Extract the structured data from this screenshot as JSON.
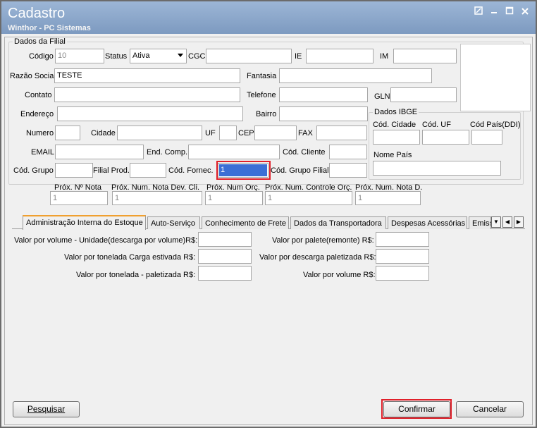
{
  "window": {
    "title": "Cadastro",
    "subtitle": "Winthor - PC Sistemas"
  },
  "dados_filial": {
    "group_title": "Dados da Filial",
    "codigo": {
      "label": "Código",
      "value": "10"
    },
    "status": {
      "label": "Status",
      "value": "Ativa"
    },
    "cgc": {
      "label": "CGC",
      "value": ""
    },
    "ie": {
      "label": "IE",
      "value": ""
    },
    "im": {
      "label": "IM",
      "value": ""
    },
    "razao_social": {
      "label": "Razão Social",
      "value": "TESTE"
    },
    "fantasia": {
      "label": "Fantasia",
      "value": ""
    },
    "contato": {
      "label": "Contato",
      "value": ""
    },
    "telefone": {
      "label": "Telefone",
      "value": ""
    },
    "gln": {
      "label": "GLN",
      "value": ""
    },
    "endereco": {
      "label": "Endereço",
      "value": ""
    },
    "bairro": {
      "label": "Bairro",
      "value": ""
    },
    "numero": {
      "label": "Numero",
      "value": ""
    },
    "cidade": {
      "label": "Cidade",
      "value": ""
    },
    "uf": {
      "label": "UF",
      "value": ""
    },
    "cep": {
      "label": "CEP",
      "value": ""
    },
    "fax": {
      "label": "FAX",
      "value": ""
    },
    "email": {
      "label": "EMAIL",
      "value": ""
    },
    "end_comp": {
      "label": "End. Comp.",
      "value": ""
    },
    "cod_cliente": {
      "label": "Cód. Cliente",
      "value": ""
    },
    "cod_grupo": {
      "label": "Cód. Grupo",
      "value": ""
    },
    "filial_prod": {
      "label": "Filial Prod.",
      "value": ""
    },
    "cod_fornec": {
      "label": "Cód. Fornec.",
      "value": "1"
    },
    "cod_grupo_filial": {
      "label": "Cód. Grupo Filial",
      "value": ""
    }
  },
  "dados_ibge": {
    "group_title": "Dados IBGE",
    "cod_cidade": {
      "label": "Cód. Cidade",
      "value": ""
    },
    "cod_uf": {
      "label": "Cód. UF",
      "value": ""
    },
    "cod_pais": {
      "label": "Cód País(DDI)",
      "value": ""
    },
    "nome_pais": {
      "label": "Nome País",
      "value": ""
    }
  },
  "proximos": [
    {
      "label": "Próx. Nº Nota",
      "value": "1"
    },
    {
      "label": "Próx. Num. Nota Dev. Cli.",
      "value": "1"
    },
    {
      "label": "Próx. Num Orç.",
      "value": "1"
    },
    {
      "label": "Próx. Num. Controle Orç.",
      "value": "1"
    },
    {
      "label": "Próx. Num. Nota D.",
      "value": "1"
    }
  ],
  "tabs": [
    "Administração Interna do Estoque",
    "Auto-Serviço",
    "Conhecimento de Frete",
    "Dados da Transportadora",
    "Despesas Acessórias",
    "Emiss"
  ],
  "estoque": {
    "left": [
      {
        "label": "Valor por volume - Unidade(descarga por volume)R$:",
        "value": ""
      },
      {
        "label": "Valor por tonelada Carga estivada R$:",
        "value": ""
      },
      {
        "label": "Valor por tonelada - paletizada R$:",
        "value": ""
      }
    ],
    "right": [
      {
        "label": "Valor por palete(remonte) R$:",
        "value": ""
      },
      {
        "label": "Valor por descarga paletizada R$:",
        "value": ""
      },
      {
        "label": "Valor por volume R$:",
        "value": ""
      }
    ]
  },
  "buttons": {
    "pesquisar": "Pesquisar",
    "confirmar": "Confirmar",
    "cancelar": "Cancelar"
  },
  "colors": {
    "titlebar": "#8aa6cb",
    "highlight": "#e0202a",
    "active_tab_accent": "#f0a030",
    "selection": "#3b6fd6"
  }
}
